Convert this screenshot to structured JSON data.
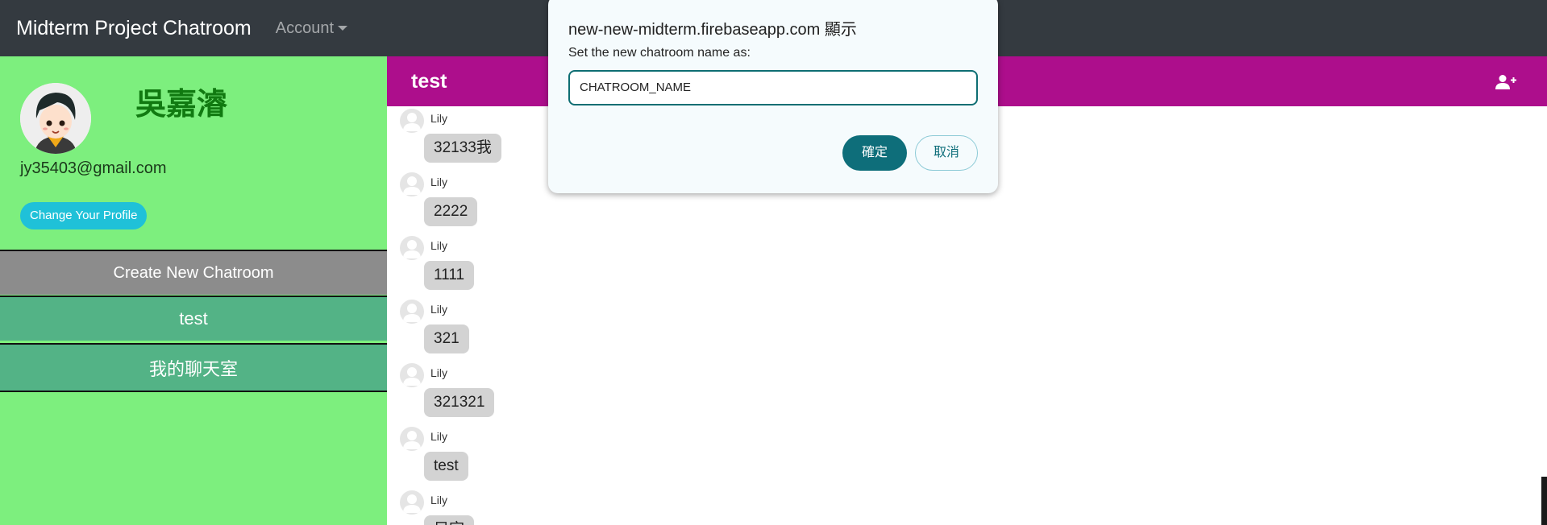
{
  "navbar": {
    "brand": "Midterm Project Chatroom",
    "account_label": "Account"
  },
  "profile": {
    "username": "吳嘉濬",
    "email": "jy35403@gmail.com",
    "change_profile_label": "Change Your Profile",
    "avatar_icon": "cartoon-avatar"
  },
  "sidebar": {
    "create_label": "Create New Chatroom",
    "rooms": [
      {
        "label": "test"
      },
      {
        "label": "我的聊天室"
      }
    ]
  },
  "chat": {
    "title": "test",
    "add_user_icon": "user-plus-icon",
    "messages": [
      {
        "sender": "Lily",
        "text": "32133我"
      },
      {
        "sender": "Lily",
        "text": "2222"
      },
      {
        "sender": "Lily",
        "text": "1111"
      },
      {
        "sender": "Lily",
        "text": "321"
      },
      {
        "sender": "Lily",
        "text": "321321"
      },
      {
        "sender": "Lily",
        "text": "test"
      },
      {
        "sender": "Lily",
        "text": "目宗"
      }
    ]
  },
  "dialog": {
    "origin_title": "new-new-midterm.firebaseapp.com 顯示",
    "message": "Set the new chatroom name as:",
    "input_value": "CHATROOM_NAME",
    "ok_label": "確定",
    "cancel_label": "取消"
  },
  "colors": {
    "navbar": "#343a40",
    "sidebar": "#7def7e",
    "chat_header": "#ad0e8c",
    "room_item": "#53b386",
    "create_item": "#8c8c8c",
    "profile_button": "#1fc1d8",
    "dialog_accent": "#0e6e7a"
  }
}
